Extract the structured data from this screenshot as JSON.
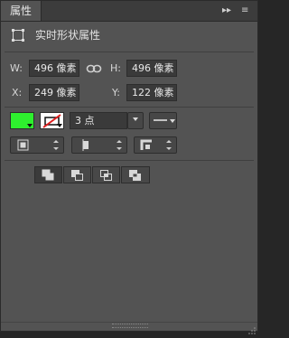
{
  "panel": {
    "tab_label": "属性",
    "collapse_glyph": "▸▸",
    "menu_glyph": "≡"
  },
  "header": {
    "title": "实时形状属性",
    "icon": "rectangle-shape-icon"
  },
  "transform": {
    "w_label": "W:",
    "w_value": "496 像素",
    "h_label": "H:",
    "h_value": "496 像素",
    "x_label": "X:",
    "x_value": "249 像素",
    "y_label": "Y:",
    "y_value": "122 像素",
    "link_icon": "chain-link-icon"
  },
  "appearance": {
    "fill_color": "#2ef02e",
    "stroke_color": "none",
    "stroke_width": "3 点",
    "stroke_line_style": "solid-line"
  },
  "options": {
    "align_icon": "stroke-align-icon",
    "caps_icon": "line-caps-icon",
    "corners_icon": "line-corners-icon"
  },
  "path_operations": [
    {
      "name": "combine-shapes-icon",
      "active": true
    },
    {
      "name": "subtract-front-shape-icon",
      "active": false
    },
    {
      "name": "intersect-shape-areas-icon",
      "active": false
    },
    {
      "name": "exclude-overlapping-shapes-icon",
      "active": false
    }
  ]
}
